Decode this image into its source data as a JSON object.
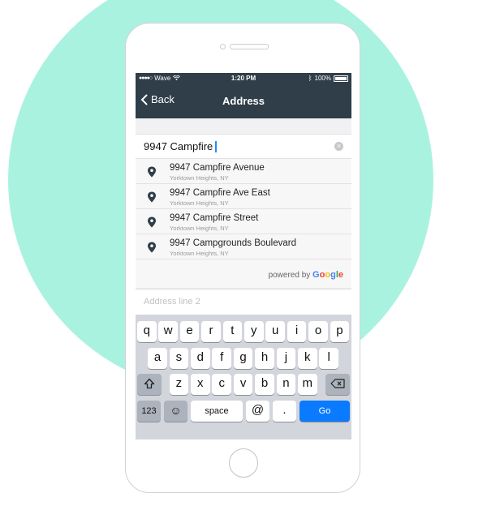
{
  "status_bar": {
    "carrier": "Wave",
    "time": "1:20 PM",
    "battery": "100%"
  },
  "nav": {
    "back_label": "Back",
    "title": "Address"
  },
  "search": {
    "value": "9947 Campfire"
  },
  "results": [
    {
      "main": "9947 Campfire Avenue",
      "sub": "Yorktown Heights, NY"
    },
    {
      "main": "9947 Campfire Ave East",
      "sub": "Yorktown Heights, NY"
    },
    {
      "main": "9947 Campfire Street",
      "sub": "Yorktown Heights, NY"
    },
    {
      "main": "9947 Campgrounds Boulevard",
      "sub": "Yorktown Heights, NY"
    }
  ],
  "powered_by": {
    "prefix": "powered by ",
    "brand": "Google"
  },
  "address_line2": {
    "placeholder": "Address line 2"
  },
  "keyboard": {
    "row1": [
      "q",
      "w",
      "e",
      "r",
      "t",
      "y",
      "u",
      "i",
      "o",
      "p"
    ],
    "row2": [
      "a",
      "s",
      "d",
      "f",
      "g",
      "h",
      "j",
      "k",
      "l"
    ],
    "row3": [
      "z",
      "x",
      "c",
      "v",
      "b",
      "n",
      "m"
    ],
    "numbers_label": "123",
    "space_label": "space",
    "at_label": "@",
    "dot_label": ".",
    "go_label": "Go"
  },
  "colors": {
    "accent": "#0a7aff",
    "navbar": "#2f3e48",
    "background_circle": "#aaf2e0"
  }
}
